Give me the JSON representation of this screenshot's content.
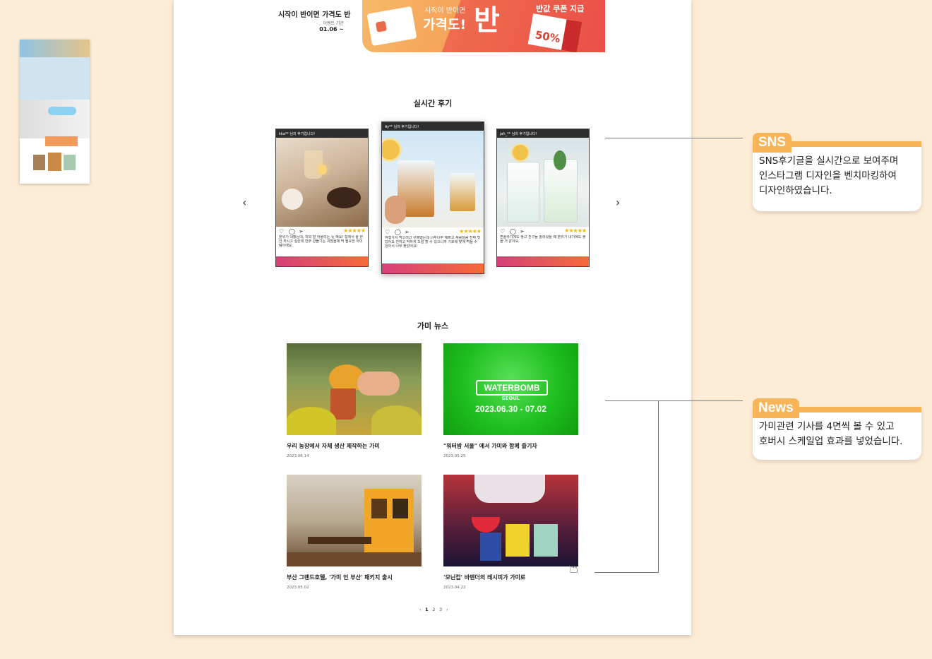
{
  "event": {
    "title": "시작이 반이면 가격도 반",
    "period_label": "이벤트 기간",
    "date": "01.06 ~"
  },
  "banner": {
    "small_text": "시작이 반이면",
    "big_text": "가격도!",
    "ban_text": "반",
    "coupon_text": "반값 쿠폰 지급",
    "percent": "50%"
  },
  "reviews": {
    "title": "실시간 후기",
    "prev_label": "‹",
    "next_label": "›",
    "posts": [
      {
        "user": "kka** 님의 후기입니다!",
        "stars": "★★★★★",
        "text": "분위기 내봤는데, 의외 잘 어울리는 듯 해요! 집에서 술 한잔 하시고 싶은데 반주 만들기는 귀찮을때 딱 필요한 아이템이에요."
      },
      {
        "user": "Ay** 님의 후기입니다!",
        "stars": "★★★★★",
        "text": "여행가서 먹으려고 구매했는데 너무너무 예쁘고 새콤달콤 진짜 맛있어요 친하고 막하게 조절 할 수 있으니까 기호에 맞게 먹을 수 있어서 너무 좋았어요!"
      },
      {
        "user": "jah_** 님의 후기입니다!",
        "stars": "★★★★★",
        "text": "혼술하기에도 좋고 친구들 놀러왔을 때 분위기 내기에도 좋을 거 같아요."
      }
    ]
  },
  "news": {
    "title": "가미 뉴스",
    "items": [
      {
        "caption": "우리 농장에서 자체 생산 제작하는 가미",
        "date": "2023.06.14"
      },
      {
        "caption": "\"워터밤 서울\" 에서 가미와 함께 즐기자",
        "date": "2023.05.25"
      },
      {
        "caption": "부산 그랜드호텔, '가미 인 부산' 패키지 출시",
        "date": "2023.05.02"
      },
      {
        "caption": "'모닌컵' 바텐더의 레시피가 가미로",
        "date": "2023.04.22"
      }
    ],
    "waterbomb": {
      "logo": "WATERBOMB",
      "city": "SEOUL",
      "dates": "2023.06.30 - 07.02"
    },
    "pager": {
      "prev": "‹",
      "pages": [
        "1",
        "2",
        "3"
      ],
      "next": "›"
    }
  },
  "notes": {
    "sns": {
      "tag": "SNS",
      "lines": [
        "SNS후기글을 실시간으로 보여주며",
        "인스타그램 디자인을 벤치마킹하여",
        "디자인하였습니다."
      ]
    },
    "news": {
      "tag": "News",
      "lines": [
        "가미관련 기사를 4면씩 볼 수 있고",
        "호버시 스케일업 효과를 넣었습니다."
      ]
    }
  },
  "colors": {
    "background": "#fdecd6",
    "accent": "#f9b458",
    "instagram_bar": "#e2506a",
    "waterbomb_green": "#1fbf1f"
  },
  "icons": [
    "heart-icon",
    "comment-icon",
    "send-icon",
    "star-icon",
    "chevron-left-icon",
    "chevron-right-icon",
    "hand-cursor-icon"
  ]
}
